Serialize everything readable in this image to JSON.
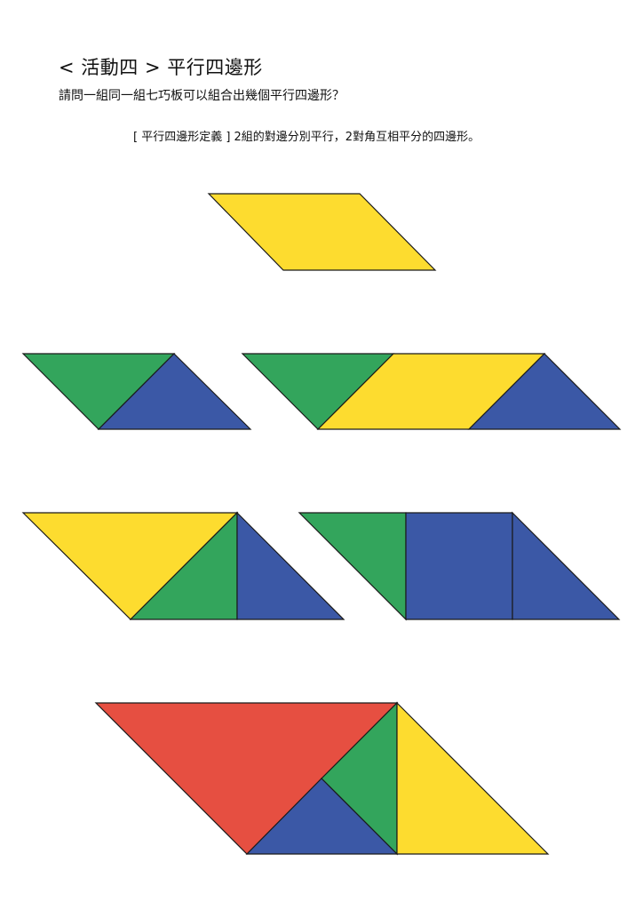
{
  "heading": {
    "title": "< 活動四 > 平行四邊形",
    "question": "請問一組同一組七巧板可以組合出幾個平行四邊形？",
    "definition": "[ 平行四邊形定義 ] 2組的對邊分別平行，2對角互相平分的四邊形。"
  },
  "colors": {
    "yellow": "#FDDC2F",
    "green": "#33A55C",
    "blue": "#3B58A6",
    "red": "#E64F41"
  }
}
